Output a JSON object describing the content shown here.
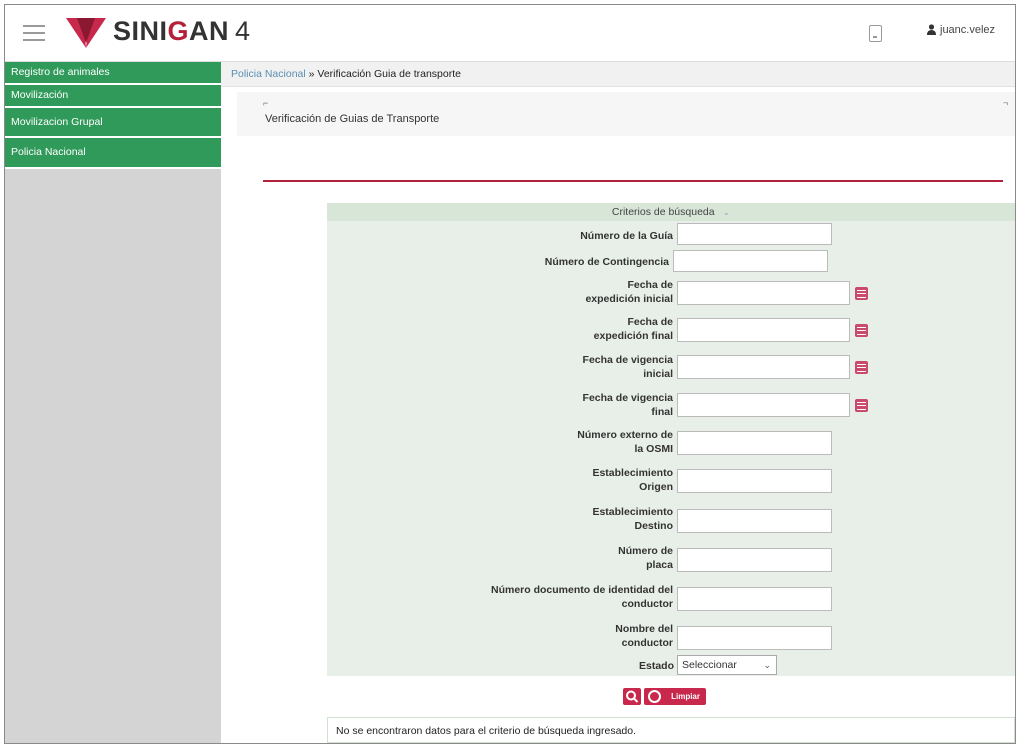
{
  "header": {
    "logo_brand": "SINI",
    "logo_brand_red": "G",
    "logo_brand_end": "AN",
    "logo_version": "4",
    "user_name": "juanc.velez"
  },
  "sidebar": {
    "items": [
      {
        "label": "Registro de animales"
      },
      {
        "label": "Movilización"
      },
      {
        "label": "Movilizacion Grupal"
      },
      {
        "label": "Policia Nacional"
      }
    ]
  },
  "breadcrumb": {
    "parent": "Policia Nacional",
    "separator": " » ",
    "current": "Verificación Guia de transporte"
  },
  "panel": {
    "title": "Verificación de Guias de Transporte"
  },
  "search": {
    "title": "Criterios de búsqueda",
    "fields": {
      "numero_guia": "Número de la Guía",
      "numero_contingencia": "Número de Contingencia",
      "fecha_exp_inicial_1": "Fecha de",
      "fecha_exp_inicial_2": "expedición inicial",
      "fecha_exp_final_1": "Fecha de",
      "fecha_exp_final_2": "expedición final",
      "fecha_vig_inicial_1": "Fecha de vigencia",
      "fecha_vig_inicial_2": "inicial",
      "fecha_vig_final_1": "Fecha de vigencia",
      "fecha_vig_final_2": "final",
      "osmi_1": "Número externo de",
      "osmi_2": "la OSMI",
      "est_origen_1": "Establecimiento",
      "est_origen_2": "Origen",
      "est_destino_1": "Establecimiento",
      "est_destino_2": "Destino",
      "placa_1": "Número de",
      "placa_2": "placa",
      "doc_conductor_1": "Número documento de identidad del",
      "doc_conductor_2": "conductor",
      "nombre_conductor_1": "Nombre del",
      "nombre_conductor_2": "conductor",
      "estado": "Estado"
    },
    "estado_value": "Seleccionar",
    "clean_label": "Limpiar"
  },
  "result": {
    "message": "No se encontraron datos para el criterio de búsqueda ingresado."
  },
  "colors": {
    "sidebar_green": "#2f9a5a",
    "brand_red": "#b3203a",
    "button_red": "#c8284c",
    "form_bg": "#e8efe8"
  }
}
